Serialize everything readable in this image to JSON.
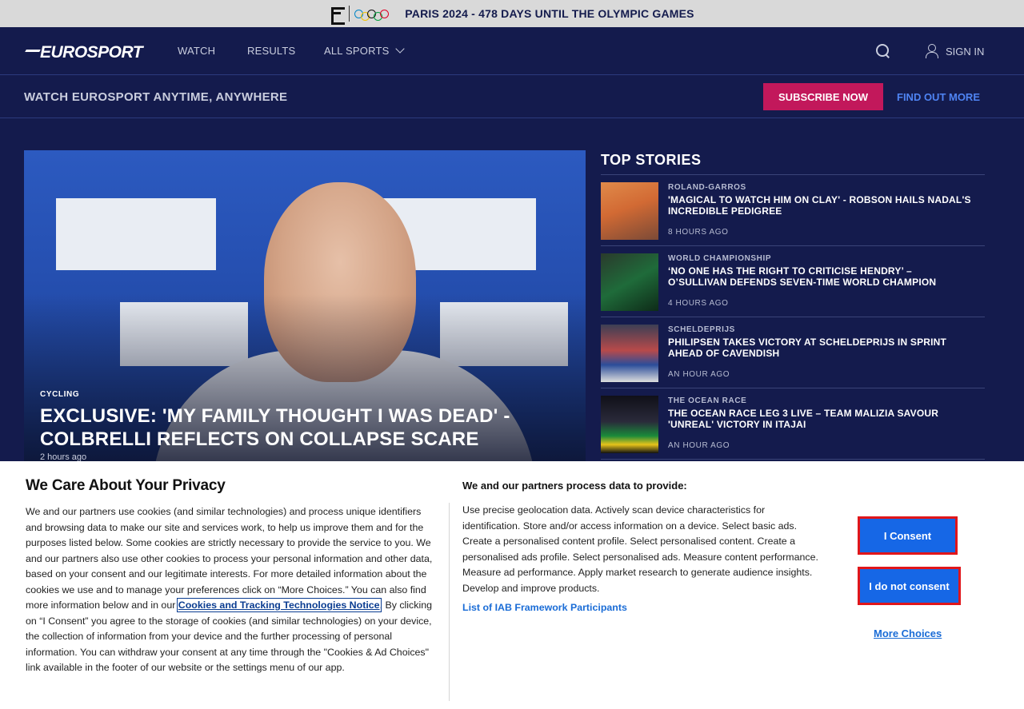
{
  "olympic_banner": {
    "text": "PARIS 2024 - 478 DAYS UNTIL THE OLYMPIC GAMES"
  },
  "nav": {
    "logo": "EUROSPORT",
    "links": [
      "WATCH",
      "RESULTS",
      "ALL SPORTS"
    ],
    "signin": "SIGN IN"
  },
  "subscribe": {
    "title": "WATCH EUROSPORT ANYTIME, ANYWHERE",
    "button": "SUBSCRIBE NOW",
    "find_out": "FIND OUT MORE"
  },
  "hero": {
    "category": "CYCLING",
    "title": "EXCLUSIVE: 'MY FAMILY THOUGHT I WAS DEAD' - COLBRELLI REFLECTS ON COLLAPSE SCARE",
    "time": "2 hours ago"
  },
  "top_stories": {
    "heading": "TOP STORIES",
    "items": [
      {
        "category": "ROLAND-GARROS",
        "title": "'MAGICAL TO WATCH HIM ON CLAY' - ROBSON HAILS NADAL'S INCREDIBLE PEDIGREE",
        "time": "8 HOURS AGO"
      },
      {
        "category": "WORLD CHAMPIONSHIP",
        "title": "‘NO ONE HAS THE RIGHT TO CRITICISE HENDRY’ – O’SULLIVAN DEFENDS SEVEN-TIME WORLD CHAMPION",
        "time": "4 HOURS AGO"
      },
      {
        "category": "SCHELDEPRIJS",
        "title": "PHILIPSEN TAKES VICTORY AT SCHELDEPRIJS IN SPRINT AHEAD OF CAVENDISH",
        "time": "AN HOUR AGO"
      },
      {
        "category": "THE OCEAN RACE",
        "title": "THE OCEAN RACE LEG 3 LIVE – TEAM MALIZIA SAVOUR 'UNREAL' VICTORY IN ITAJAI",
        "time": "AN HOUR AGO"
      }
    ]
  },
  "cookie": {
    "title": "We Care About Your Privacy",
    "body_1": "We and our partners use cookies (and similar technologies) and process unique identifiers and browsing data to make our site and services work, to help us improve them and for the purposes listed below. Some cookies are strictly necessary to provide the service to you. We and our partners also use other cookies to process your personal information and other data, based on your consent and our legitimate interests. For more detailed information about the cookies we use and to manage your preferences click on “More Choices.” You can also find more information below and in our ",
    "link": "Cookies and Tracking Technologies Notice",
    "body_2": ". By clicking on “I Consent” you agree to the storage of cookies (and similar technologies) on your device, the collection of information from your device and the further processing of personal information. You can withdraw your consent at any time through the \"Cookies & Ad Choices\" link available in the footer of our website or the settings menu of our app.",
    "right_title": "We and our partners process data to provide:",
    "purposes": "Use precise geolocation data. Actively scan device characteristics for identification. Store and/or access information on a device. Select basic ads. Create a personalised content profile. Select personalised content. Create a personalised ads profile. Select personalised ads. Measure content performance. Measure ad performance. Apply market research to generate audience insights. Develop and improve products.",
    "iab_link": "List of IAB Framework Participants",
    "consent": "I Consent",
    "no_consent": "I do not consent",
    "more_choices": "More Choices"
  }
}
